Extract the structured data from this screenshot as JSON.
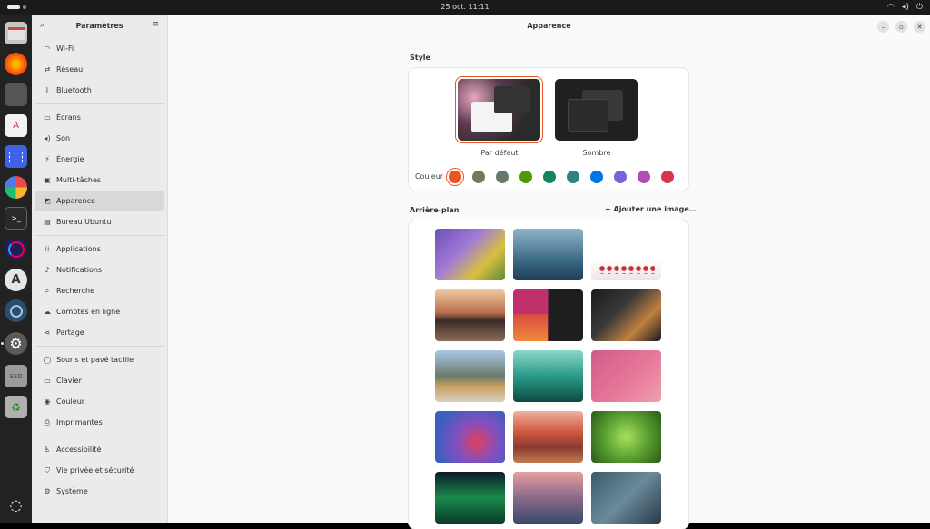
{
  "topbar": {
    "clock": "25 oct.  11:11"
  },
  "sidebar": {
    "title": "Paramètres",
    "groups": [
      [
        {
          "icon": "wifi-icon",
          "glyph": "◠",
          "label": "Wi-Fi"
        },
        {
          "icon": "network-icon",
          "glyph": "⇄",
          "label": "Réseau"
        },
        {
          "icon": "bluetooth-icon",
          "glyph": "ᛒ",
          "label": "Bluetooth"
        }
      ],
      [
        {
          "icon": "display-icon",
          "glyph": "▭",
          "label": "Écrans"
        },
        {
          "icon": "sound-icon",
          "glyph": "◂)",
          "label": "Son"
        },
        {
          "icon": "power-icon",
          "glyph": "⚡",
          "label": "Énergie"
        },
        {
          "icon": "multitasking-icon",
          "glyph": "▣",
          "label": "Multi-tâches"
        },
        {
          "icon": "appearance-icon",
          "glyph": "◩",
          "label": "Apparence",
          "active": true
        },
        {
          "icon": "ubuntu-desktop-icon",
          "glyph": "▤",
          "label": "Bureau Ubuntu"
        }
      ],
      [
        {
          "icon": "apps-icon",
          "glyph": "⁞⁞",
          "label": "Applications"
        },
        {
          "icon": "bell-icon",
          "glyph": "♪",
          "label": "Notifications"
        },
        {
          "icon": "search-icon",
          "glyph": "⌕",
          "label": "Recherche"
        },
        {
          "icon": "cloud-icon",
          "glyph": "☁",
          "label": "Comptes en ligne"
        },
        {
          "icon": "share-icon",
          "glyph": "⋖",
          "label": "Partage"
        }
      ],
      [
        {
          "icon": "mouse-icon",
          "glyph": "◯",
          "label": "Souris et pavé tactile"
        },
        {
          "icon": "keyboard-icon",
          "glyph": "▭",
          "label": "Clavier"
        },
        {
          "icon": "color-icon",
          "glyph": "◉",
          "label": "Couleur"
        },
        {
          "icon": "printer-icon",
          "glyph": "⎙",
          "label": "Imprimantes"
        }
      ],
      [
        {
          "icon": "accessibility-icon",
          "glyph": "♿",
          "label": "Accessibilité"
        },
        {
          "icon": "privacy-icon",
          "glyph": "⛉",
          "label": "Vie privée et sécurité"
        },
        {
          "icon": "system-icon",
          "glyph": "⚙",
          "label": "Système"
        }
      ]
    ]
  },
  "main": {
    "title": "Apparence",
    "style_heading": "Style",
    "style_default": "Par défaut",
    "style_dark": "Sombre",
    "color_label": "Couleur",
    "accent_colors": [
      "#e95420",
      "#787859",
      "#657b69",
      "#4e9a06",
      "#18845a",
      "#308280",
      "#0073e5",
      "#7764d8",
      "#b34cb3",
      "#da3450"
    ],
    "bg_heading": "Arrière-plan",
    "add_image": "Ajouter une image…"
  }
}
